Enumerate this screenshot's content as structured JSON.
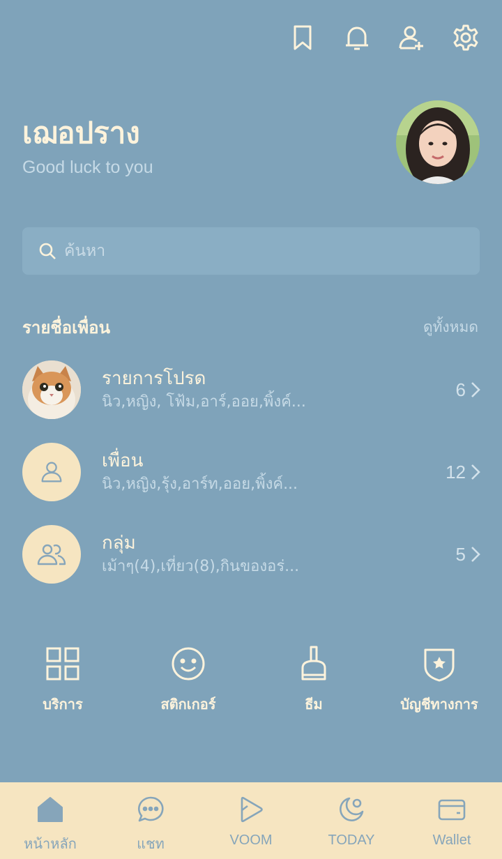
{
  "colors": {
    "background": "#7fa3ba",
    "cream": "#f6e5c1",
    "accent_text": "#fdf3dc",
    "muted": "#c6dae6"
  },
  "header": {
    "icons": [
      "bookmark-icon",
      "bell-icon",
      "add-friend-icon",
      "gear-icon"
    ]
  },
  "profile": {
    "name": "เฌอปราง",
    "status": "Good luck to you"
  },
  "search": {
    "placeholder": "ค้นหา"
  },
  "friends_section": {
    "title": "รายชื่อเพื่อน",
    "see_all": "ดูทั้งหมด",
    "rows": [
      {
        "title": "รายการโปรด",
        "subtitle": "นิว,หญิง, โฟ้ม,อาร์,ออย,พิ้งค์...",
        "count": "6"
      },
      {
        "title": "เพื่อน",
        "subtitle": "นิว,หญิง,รุ้ง,อาร์ท,ออย,พิ้งค์...",
        "count": "12"
      },
      {
        "title": "กลุ่ม",
        "subtitle": "เม้าๆ(4),เที่ยว(8),กินของอร่...",
        "count": "5"
      }
    ]
  },
  "services": [
    {
      "label": "บริการ",
      "icon": "grid-icon"
    },
    {
      "label": "สติกเกอร์",
      "icon": "smiley-icon"
    },
    {
      "label": "ธีม",
      "icon": "paint-brush-icon"
    },
    {
      "label": "บัญชีทางการ",
      "icon": "shield-star-icon"
    }
  ],
  "tabbar": [
    {
      "label": "หน้าหลัก",
      "icon": "home-icon",
      "active": true
    },
    {
      "label": "แชท",
      "icon": "chat-icon"
    },
    {
      "label": "VOOM",
      "icon": "voom-play-icon"
    },
    {
      "label": "TODAY",
      "icon": "moon-icon"
    },
    {
      "label": "Wallet",
      "icon": "wallet-icon"
    }
  ]
}
